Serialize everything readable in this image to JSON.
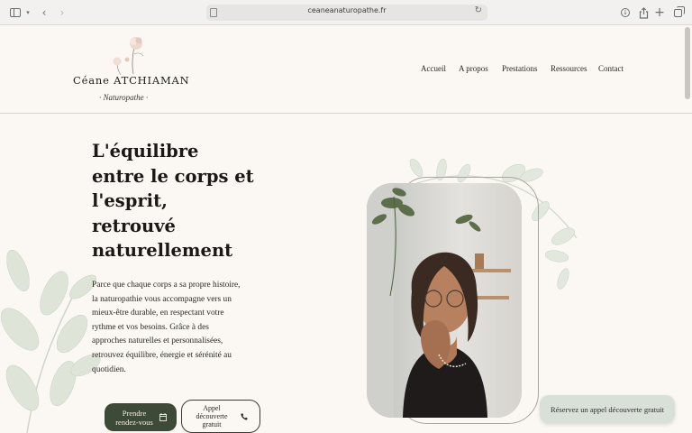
{
  "browser": {
    "url": "ceaneanaturopathe.fr",
    "icons": [
      "sidebar-icon",
      "chevron-down-icon",
      "back-arrow-icon",
      "forward-arrow-icon",
      "page-icon",
      "reload-icon",
      "download-icon",
      "share-icon",
      "new-tab-icon",
      "tabs-overview-icon"
    ]
  },
  "logo": {
    "name": "Céane ATCHIAMAN",
    "subtitle": "·  Naturopathe  ·"
  },
  "nav": {
    "items": [
      "Accueil",
      "A propos",
      "Prestations",
      "Ressources",
      "Contact"
    ]
  },
  "hero": {
    "title": "L'équilibre entre le corps et l'esprit, retrouvé naturellement",
    "description": "Parce que chaque corps a sa propre histoire, la naturopathie vous accompagne vers un mieux-être durable, en respectant votre rythme et vos besoins. Grâce à des approches naturelles et personnalisées, retrouvez équilibre, énergie et sérénité au quotidien.",
    "primary_button": "Prendre rendez-vous",
    "secondary_button": "Appel découverte gratuit"
  },
  "floating_button": "Réservez un appel découverte gratuit",
  "colors": {
    "background": "#fbf8f3",
    "accent_dark_green": "#3d4a37",
    "sage_light": "#d9e0d8"
  }
}
